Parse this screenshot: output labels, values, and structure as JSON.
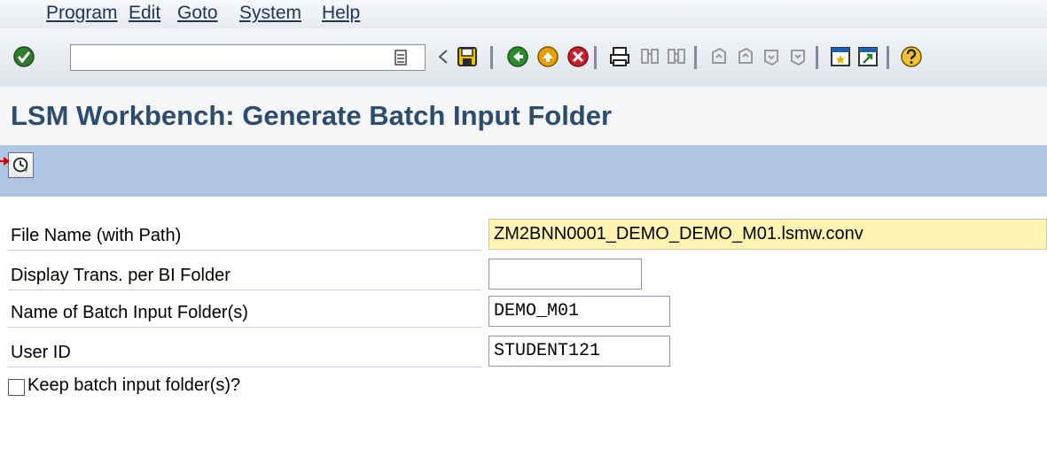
{
  "menu": {
    "items": [
      {
        "label": "Program"
      },
      {
        "label": "Edit"
      },
      {
        "label": "Goto"
      },
      {
        "label": "System"
      },
      {
        "label": "Help"
      }
    ]
  },
  "toolbar": {
    "command_value": "",
    "icons": [
      "enter-icon",
      "save-icon",
      "back-icon",
      "exit-icon",
      "cancel-icon",
      "print-icon",
      "find-icon",
      "find-next-icon",
      "first-page-icon",
      "previous-page-icon",
      "next-page-icon",
      "last-page-icon",
      "create-session-icon",
      "create-shortcut-icon",
      "help-icon"
    ]
  },
  "title": "LSM Workbench: Generate Batch Input Folder",
  "app_toolbar": {
    "execute_icon": "execute-clock-icon"
  },
  "form": {
    "file_name": {
      "label": "File Name (with Path)",
      "value": "ZM2BNN0001_DEMO_DEMO_M01.lsmw.conv"
    },
    "display_trans": {
      "label": "Display Trans. per BI Folder",
      "value": ""
    },
    "folder_name": {
      "label": "Name of Batch Input Folder(s)",
      "value": "DEMO_M01"
    },
    "user_id": {
      "label": "User ID",
      "value": "STUDENT121"
    },
    "keep_folder": {
      "label": "Keep batch input folder(s)?",
      "checked": false
    }
  },
  "colors": {
    "title": "#2e4c6e",
    "app_toolbar": "#aec6e4",
    "required_field": "#fef3b0",
    "annotation_arrow": "#d10000"
  }
}
